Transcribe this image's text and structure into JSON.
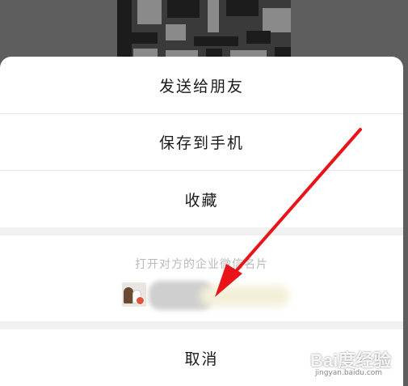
{
  "action_sheet": {
    "items": [
      {
        "label": "发送给朋友"
      },
      {
        "label": "保存到手机"
      },
      {
        "label": "收藏"
      }
    ],
    "section_title": "打开对方的企业微信名片",
    "cancel_label": "取消"
  },
  "watermark": {
    "logo": "Bai度经验",
    "url": "jingyan.baidu.com"
  },
  "colors": {
    "annotation_arrow": "#e8141a",
    "sheet_background": "#ffffff",
    "section_gap": "#f1f1f1"
  }
}
